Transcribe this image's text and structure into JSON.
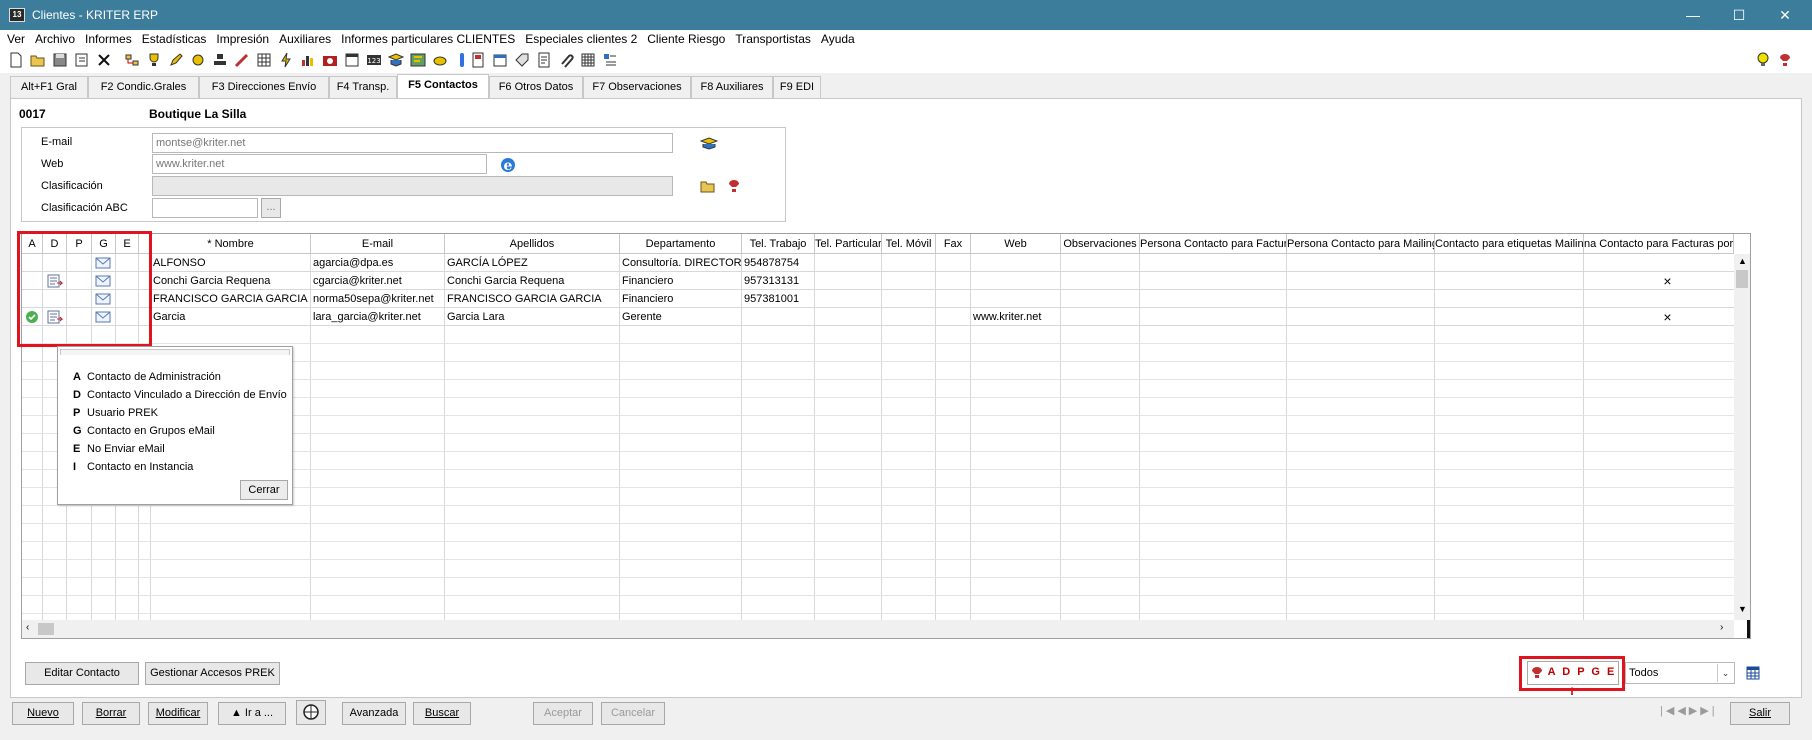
{
  "window": {
    "title": "Clientes - KRITER ERP",
    "icon_text": "13",
    "minimize": "—",
    "maximize": "☐",
    "close": "✕"
  },
  "menu": [
    "Ver",
    "Archivo",
    "Informes",
    "Estadísticas",
    "Impresión",
    "Auxiliares",
    "Informes particulares CLIENTES",
    "Especiales clientes 2",
    "Cliente Riesgo",
    "Transportistas",
    "Ayuda"
  ],
  "toolbar": {
    "icons": [
      "new-document-icon",
      "open-folder-icon",
      "save-icon",
      "edit-document-icon",
      "delete-x-icon",
      "tree-icon",
      "trophy-icon",
      "pencil-icon",
      "money-icon",
      "stamp-icon",
      "tools-icon",
      "table-icon",
      "lightning-icon",
      "bar-chart-icon",
      "camera-icon",
      "window-icon",
      "numeric-123-icon",
      "contact-card-icon",
      "map-icon",
      "phone-icon",
      "clip-icon",
      "book-icon",
      "calendar-icon",
      "tag-icon",
      "report-icon",
      "attach-icon",
      "grid-icon",
      "list-icon"
    ],
    "right_icons": [
      "lightbulb-icon",
      "help-icon"
    ]
  },
  "tabs": [
    "Alt+F1 Gral",
    "F2 Condic.Grales",
    "F3 Direcciones Envío",
    "F4 Transp.",
    "F5 Contactos",
    "F6 Otros Datos",
    "F7 Observaciones",
    "F8 Auxiliares",
    "F9 EDI"
  ],
  "active_tab": "F5 Contactos",
  "client": {
    "code": "0017",
    "name": "Boutique La Silla"
  },
  "form": {
    "email_label": "E-mail",
    "email_value": "montse@kriter.net",
    "web_label": "Web",
    "web_value": "www.kriter.net",
    "clasif_label": "Clasificación",
    "clasif_value": "",
    "clasif_abc_label": "Clasificación ABC",
    "clasif_abc_value": "",
    "ellipsis": "..."
  },
  "grid": {
    "headers": [
      "A",
      "D",
      "P",
      "G",
      "E",
      "",
      "* Nombre",
      "E-mail",
      "Apellidos",
      "Departamento",
      "Tel. Trabajo",
      "Tel. Particular",
      "Tel. Móvil",
      "Fax",
      "Web",
      "Observaciones",
      "Persona Contacto para Facturas",
      "Persona Contacto para Mailing",
      "Contacto para etiquetas Mailing",
      "na Contacto para Facturas por C",
      "("
    ],
    "rows": [
      {
        "A": "",
        "D": "",
        "G": "mail",
        "nombre": "ALFONSO",
        "email": "agarcia@dpa.es",
        "apellidos": "GARCÍA LÓPEZ",
        "departamento": "Consultoría. DIRECTOR",
        "tel_trabajo": "954878754",
        "web": "",
        "factpor": ""
      },
      {
        "A": "",
        "D": "doc",
        "G": "mail",
        "nombre": "Conchi Garcia Requena",
        "email": "cgarcia@kriter.net",
        "apellidos": "Conchi Garcia Requena",
        "departamento": "Financiero",
        "tel_trabajo": "957313131",
        "web": "",
        "factpor": "×"
      },
      {
        "A": "",
        "D": "",
        "G": "mail",
        "nombre": "FRANCISCO GARCIA GARCIA",
        "email": "norma50sepa@kriter.net",
        "apellidos": "FRANCISCO GARCIA GARCIA",
        "departamento": "Financiero",
        "tel_trabajo": "957381001",
        "web": "",
        "factpor": ""
      },
      {
        "A": "check",
        "D": "doc",
        "G": "mail",
        "nombre": "Garcia",
        "email": "lara_garcia@kriter.net",
        "apellidos": "Garcia Lara",
        "departamento": "Gerente",
        "tel_trabajo": "",
        "web": "www.kriter.net",
        "factpor": "×"
      }
    ]
  },
  "legend": {
    "items": [
      {
        "key": "A",
        "text": "Contacto de Administración"
      },
      {
        "key": "D",
        "text": "Contacto Vinculado a Dirección de Envío"
      },
      {
        "key": "P",
        "text": "Usuario PREK"
      },
      {
        "key": "G",
        "text": "Contacto en Grupos eMail"
      },
      {
        "key": "E",
        "text": "No Enviar eMail"
      },
      {
        "key": "I",
        "text": "Contacto en Instancia"
      }
    ],
    "close_button": "Cerrar"
  },
  "buttons": {
    "editar": "Editar Contacto",
    "gestionar": "Gestionar Accesos PREK",
    "legend_toggle": "A D P G E I",
    "filter_value": "Todos",
    "nuevo": "Nuevo",
    "borrar": "Borrar",
    "modificar": "Modificar",
    "ira": "▲ Ir a ...",
    "avanzada": "Avanzada",
    "buscar": "Buscar",
    "aceptar": "Aceptar",
    "cancelar": "Cancelar",
    "salir": "Salir"
  },
  "colors": {
    "titlebar": "#3c7d9c",
    "highlight": "#e0141e"
  }
}
